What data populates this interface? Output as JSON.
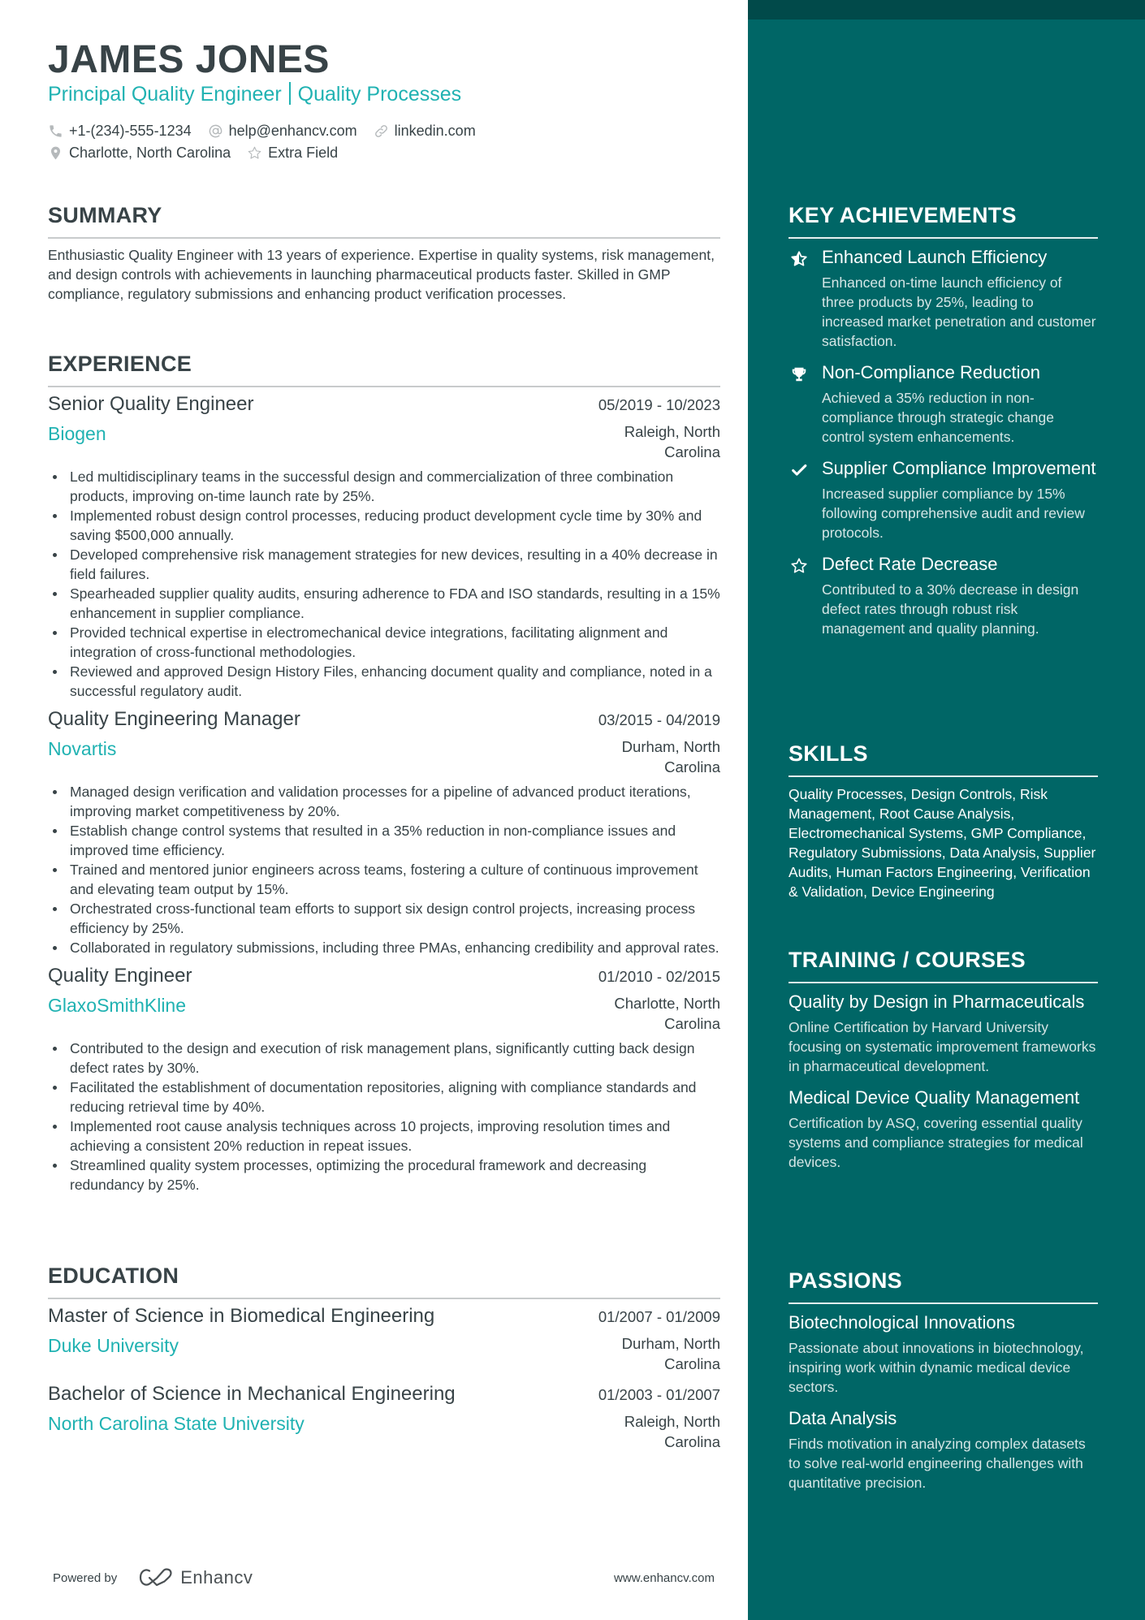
{
  "header": {
    "name": "JAMES JONES",
    "headline_part1": "Principal Quality Engineer",
    "headline_part2": "Quality Processes",
    "contacts": {
      "phone": {
        "icon": "phone-icon",
        "text": "+1-(234)-555-1234"
      },
      "email": {
        "icon": "at-icon",
        "text": "help@enhancv.com"
      },
      "link": {
        "icon": "link-icon",
        "text": "linkedin.com"
      },
      "location": {
        "icon": "location-pin-icon",
        "text": "Charlotte, North Carolina"
      },
      "extra": {
        "icon": "star-outline-icon",
        "text": "Extra Field"
      }
    }
  },
  "summary": {
    "title": "SUMMARY",
    "text": "Enthusiastic Quality Engineer with 13 years of experience. Expertise in quality systems, risk management, and design controls with achievements in launching pharmaceutical products faster. Skilled in GMP compliance, regulatory submissions and enhancing product verification processes."
  },
  "experience": {
    "title": "EXPERIENCE",
    "items": [
      {
        "role": "Senior Quality Engineer",
        "dates": "05/2019 - 10/2023",
        "company": "Biogen",
        "location": "Raleigh, North Carolina",
        "bullets": [
          "Led multidisciplinary teams in the successful design and commercialization of three combination products, improving on-time launch rate by 25%.",
          "Implemented robust design control processes, reducing product development cycle time by 30% and saving $500,000 annually.",
          "Developed comprehensive risk management strategies for new devices, resulting in a 40% decrease in field failures.",
          "Spearheaded supplier quality audits, ensuring adherence to FDA and ISO standards, resulting in a 15% enhancement in supplier compliance.",
          "Provided technical expertise in electromechanical device integrations, facilitating alignment and integration of cross-functional methodologies.",
          "Reviewed and approved Design History Files, enhancing document quality and compliance, noted in a successful regulatory audit."
        ]
      },
      {
        "role": "Quality Engineering Manager",
        "dates": "03/2015 - 04/2019",
        "company": "Novartis",
        "location": "Durham, North Carolina",
        "bullets": [
          "Managed design verification and validation processes for a pipeline of advanced product iterations, improving market competitiveness by 20%.",
          "Establish change control systems that resulted in a 35% reduction in non-compliance issues and improved time efficiency.",
          "Trained and mentored junior engineers across teams, fostering a culture of continuous improvement and elevating team output by 15%.",
          "Orchestrated cross-functional team efforts to support six design control projects, increasing process efficiency by 25%.",
          "Collaborated in regulatory submissions, including three PMAs, enhancing credibility and approval rates."
        ]
      },
      {
        "role": "Quality Engineer",
        "dates": "01/2010 - 02/2015",
        "company": "GlaxoSmithKline",
        "location": "Charlotte, North Carolina",
        "bullets": [
          "Contributed to the design and execution of risk management plans, significantly cutting back design defect rates by 30%.",
          "Facilitated the establishment of documentation repositories, aligning with compliance standards and reducing retrieval time by 40%.",
          "Implemented root cause analysis techniques across 10 projects, improving resolution times and achieving a consistent 20% reduction in repeat issues.",
          "Streamlined quality system processes, optimizing the procedural framework and decreasing redundancy by 25%."
        ]
      }
    ]
  },
  "education": {
    "title": "EDUCATION",
    "items": [
      {
        "degree": "Master of Science in Biomedical Engineering",
        "dates": "01/2007 - 01/2009",
        "school": "Duke University",
        "location": "Durham, North Carolina"
      },
      {
        "degree": "Bachelor of Science in Mechanical Engineering",
        "dates": "01/2003 - 01/2007",
        "school": "North Carolina State University",
        "location": "Raleigh, North Carolina"
      }
    ]
  },
  "footer": {
    "powered_by": "Powered by",
    "brand": "Enhancv",
    "website": "www.enhancv.com"
  },
  "sidebar": {
    "colors": {
      "background": "#006666",
      "top_strip": "#014a4a",
      "accent": "#20b2b2"
    },
    "achievements": {
      "title": "KEY ACHIEVEMENTS",
      "items": [
        {
          "icon": "star-half-icon",
          "title": "Enhanced Launch Efficiency",
          "desc": "Enhanced on-time launch efficiency of three products by 25%, leading to increased market penetration and customer satisfaction."
        },
        {
          "icon": "trophy-icon",
          "title": "Non-Compliance Reduction",
          "desc": "Achieved a 35% reduction in non-compliance through strategic change control system enhancements."
        },
        {
          "icon": "checkmark-icon",
          "title": "Supplier Compliance Improvement",
          "desc": "Increased supplier compliance by 15% following comprehensive audit and review protocols."
        },
        {
          "icon": "star-outline-icon",
          "title": "Defect Rate Decrease",
          "desc": "Contributed to a 30% decrease in design defect rates through robust risk management and quality planning."
        }
      ]
    },
    "skills": {
      "title": "SKILLS",
      "text": "Quality Processes, Design Controls, Risk Management, Root Cause Analysis, Electromechanical Systems, GMP Compliance, Regulatory Submissions, Data Analysis, Supplier Audits, Human Factors Engineering, Verification & Validation, Device Engineering"
    },
    "training": {
      "title": "TRAINING / COURSES",
      "items": [
        {
          "title": "Quality by Design in Pharmaceuticals",
          "desc": "Online Certification by Harvard University focusing on systematic improvement frameworks in pharmaceutical development."
        },
        {
          "title": "Medical Device Quality Management",
          "desc": "Certification by ASQ, covering essential quality systems and compliance strategies for medical devices."
        }
      ]
    },
    "passions": {
      "title": "PASSIONS",
      "items": [
        {
          "title": "Biotechnological Innovations",
          "desc": "Passionate about innovations in biotechnology, inspiring work within dynamic medical device sectors."
        },
        {
          "title": "Data Analysis",
          "desc": "Finds motivation in analyzing complex datasets to solve real-world engineering challenges with quantitative precision."
        }
      ]
    }
  }
}
